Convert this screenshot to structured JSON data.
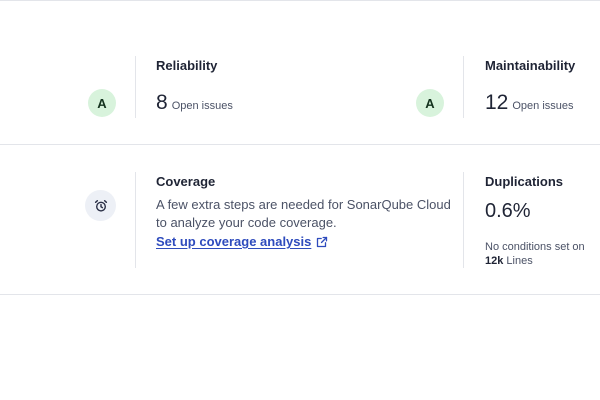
{
  "reliability": {
    "title": "Reliability",
    "rating": "A",
    "count": "8",
    "count_label": "Open issues"
  },
  "maintainability": {
    "title": "Maintainability",
    "rating": "A",
    "count": "12",
    "count_label": "Open issues"
  },
  "coverage": {
    "title": "Coverage",
    "icon": "alarm-clock-icon",
    "description": "A few extra steps are needed for SonarQube Cloud to analyze your code coverage.",
    "link_label": "Set up coverage analysis",
    "link_icon": "external-link-icon"
  },
  "duplications": {
    "title": "Duplications",
    "value": "0.6%",
    "note_prefix": "No conditions set on",
    "lines_count": "12k",
    "lines_label": "Lines"
  },
  "colors": {
    "rating_a_bg": "#d8f3dc",
    "link": "#2e4bbd",
    "divider": "#e3e5ea"
  }
}
